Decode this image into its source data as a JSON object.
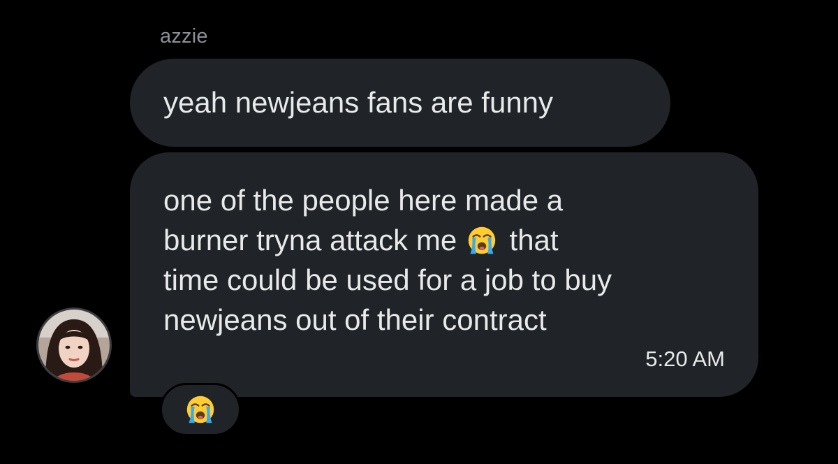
{
  "conversation": {
    "sender_name": "azzie",
    "messages": [
      {
        "text": "yeah newjeans fans are funny"
      },
      {
        "lines": [
          "one of the people here made a",
          "burner tryna attack me",
          "that",
          "time could be used for a job to buy",
          "newjeans out of their contract"
        ],
        "emoji": "loudly-crying-face-icon",
        "timestamp": "5:20 AM"
      }
    ],
    "reaction": {
      "emoji": "loudly-crying-face-icon"
    }
  },
  "colors": {
    "background": "#000000",
    "bubble": "#202327",
    "text": "#e7e9ea",
    "sender_name": "#8b9096"
  }
}
